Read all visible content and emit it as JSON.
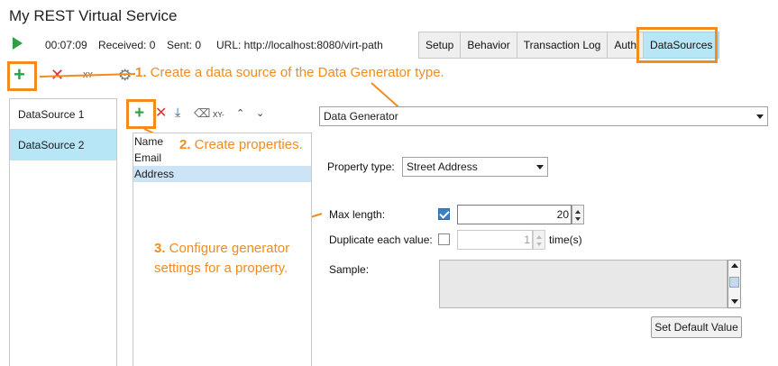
{
  "window": {
    "title": "My REST Virtual Service"
  },
  "status_bar": {
    "elapsed": "00:07:09",
    "received": "Received: 0",
    "sent": "Sent: 0",
    "url": "URL: http://localhost:8080/virt-path"
  },
  "tabs": [
    {
      "label": "Setup"
    },
    {
      "label": "Behavior"
    },
    {
      "label": "Transaction Log"
    },
    {
      "label": "Auth"
    },
    {
      "label": "DataSources",
      "active": true
    }
  ],
  "top_toolbar": {
    "rename_label": "XY"
  },
  "datasources": [
    {
      "label": "DataSource 1"
    },
    {
      "label": "DataSource 2",
      "selected": true
    }
  ],
  "datasource_type": {
    "selected": "Data Generator"
  },
  "properties_toolbar": {
    "rename_label": "XY"
  },
  "properties": [
    {
      "label": "Name"
    },
    {
      "label": "Email"
    },
    {
      "label": "Address",
      "selected": true
    }
  ],
  "property_settings": {
    "type_label": "Property type:",
    "type_value": "Street Address",
    "max_length_label": "Max length:",
    "max_length_checked": true,
    "max_length_value": "20",
    "duplicate_label": "Duplicate each value:",
    "duplicate_checked": false,
    "duplicate_value": "1",
    "duplicate_unit": "time(s)",
    "sample_label": "Sample:",
    "default_button": "Set Default Value"
  },
  "annotations": {
    "step1_num": "1.",
    "step1_text": " Create a data source of the Data Generator type.",
    "step2_num": "2.",
    "step2_text": " Create properties.",
    "step3_num": "3.",
    "step3_line1": " Configure generator",
    "step3_line2": "settings for a property."
  },
  "colors": {
    "accent_orange": "#f28c1e",
    "selected_blue": "#b7e6f7",
    "add_green": "#2f9e44",
    "delete_red": "#e03131"
  }
}
